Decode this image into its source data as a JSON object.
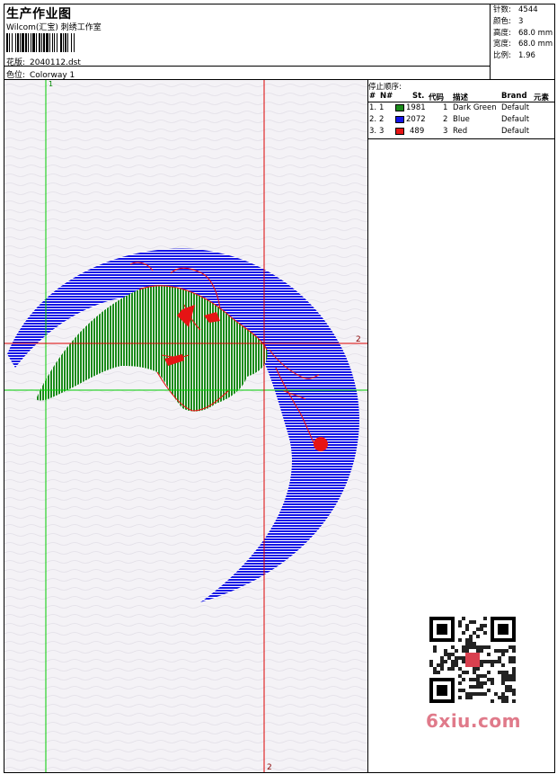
{
  "header": {
    "title": "生产作业图",
    "studio": "Wilcom(汇宝) 刺绣工作室",
    "design_label": "花版:",
    "design_value": "2040112.dst",
    "colorway_label": "色位:",
    "colorway_value": "Colorway 1"
  },
  "stats": [
    {
      "label": "针数:",
      "value": "4544"
    },
    {
      "label": "颜色:",
      "value": "3"
    },
    {
      "label": "高度:",
      "value": "68.0 mm"
    },
    {
      "label": "宽度:",
      "value": "68.0 mm"
    },
    {
      "label": "比例:",
      "value": "1.96"
    }
  ],
  "stop_sequence": {
    "label": "停止顺序:",
    "headers": {
      "hash": "#",
      "n": "N#",
      "stitches": "St.",
      "code": "代码",
      "desc": "描述",
      "brand": "Brand",
      "element": "元素"
    },
    "rows": [
      {
        "idx": "1.",
        "n": "1",
        "color": "#1a8a1a",
        "stitches": "1981",
        "code": "1",
        "desc": "Dark Green",
        "brand": "Default"
      },
      {
        "idx": "2.",
        "n": "2",
        "color": "#1414e6",
        "stitches": "2072",
        "code": "2",
        "desc": "Blue",
        "brand": "Default"
      },
      {
        "idx": "3.",
        "n": "3",
        "color": "#e61414",
        "stitches": "489",
        "code": "3",
        "desc": "Red",
        "brand": "Default"
      }
    ]
  },
  "guides": {
    "marker_green": "1",
    "marker_red_h": "2",
    "marker_red_v": "2"
  },
  "colors": {
    "green": "#1a8a1a",
    "blue": "#1414e6",
    "red": "#e61414",
    "guide_green": "#00cc00",
    "guide_red": "#dd0000"
  },
  "watermark": "6xiu.com"
}
